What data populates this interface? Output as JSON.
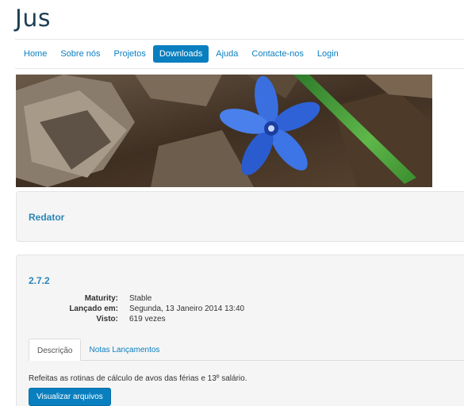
{
  "site": {
    "title": "Jus"
  },
  "nav": {
    "items": [
      {
        "label": "Home",
        "active": false
      },
      {
        "label": "Sobre nós",
        "active": false
      },
      {
        "label": "Projetos",
        "active": false
      },
      {
        "label": "Downloads",
        "active": true
      },
      {
        "label": "Ajuda",
        "active": false
      },
      {
        "label": "Contacte-nos",
        "active": false
      },
      {
        "label": "Login",
        "active": false
      }
    ]
  },
  "banner": {
    "image": "blue-flower-on-dry-leaves"
  },
  "category": {
    "title": "Redator"
  },
  "release": {
    "version": "2.7.2",
    "meta": [
      {
        "label": "Maturity:",
        "value": "Stable"
      },
      {
        "label": "Lançado em:",
        "value": "Segunda, 13 Janeiro 2014 13:40"
      },
      {
        "label": "Visto:",
        "value": "619 vezes"
      }
    ],
    "tabs": [
      {
        "label": "Descrição",
        "active": true
      },
      {
        "label": "Notas Lançamentos",
        "active": false
      }
    ],
    "description": "Refeitas as rotinas de cálculo de avos das férias e 13º salário.",
    "button_label": "Visualizar arquivos"
  },
  "colors": {
    "accent": "#0a7fbf",
    "link": "#0a7ec0",
    "heading": "#2a86b8",
    "title": "#1b3f55"
  }
}
